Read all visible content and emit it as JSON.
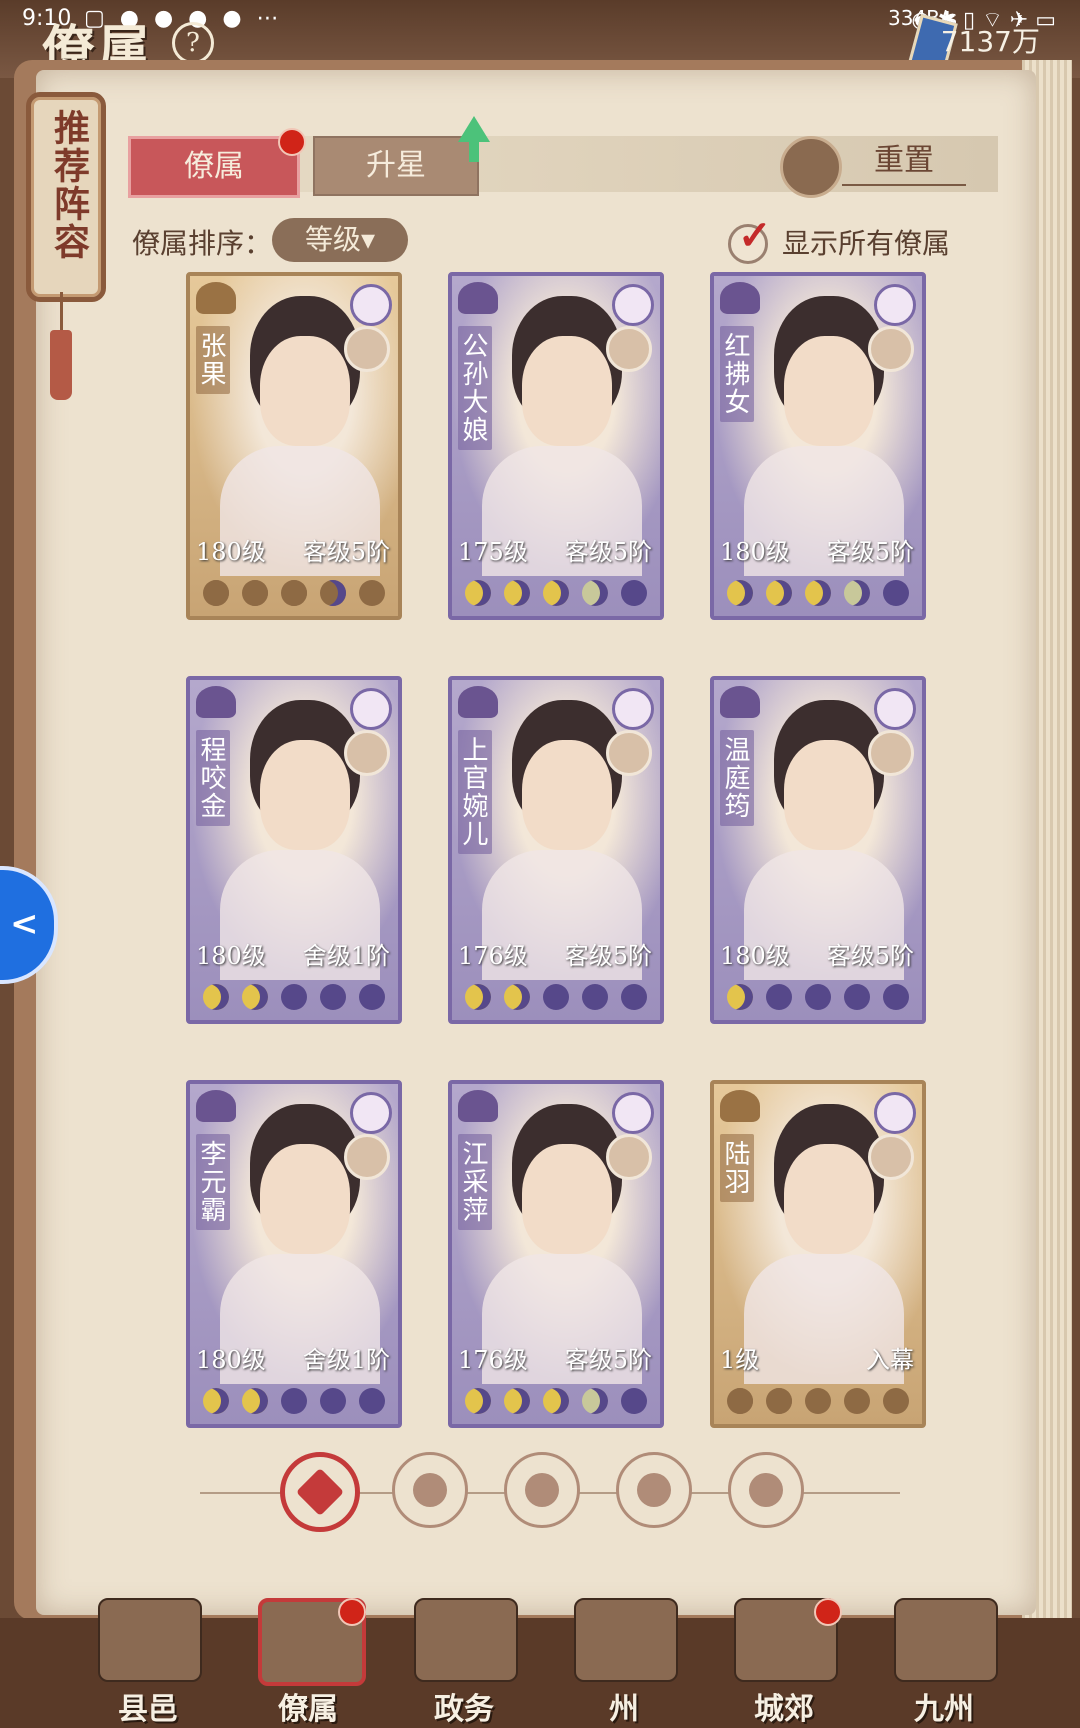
{
  "statusbar": {
    "time": "9:10",
    "notif_icons": "▢ ● ● ● ● ⋯",
    "speed": "334B/s",
    "right_icons": "◉ ✱ ▯ ⌔ ✈ ▭"
  },
  "header": {
    "title": "僚属",
    "help": "?",
    "currency": "7137万"
  },
  "recommend_tag": "推荐阵容",
  "tabs": [
    {
      "label": "僚属"
    },
    {
      "label": "升星"
    }
  ],
  "reset_label": "重置",
  "sort": {
    "label": "僚属排序：",
    "value": "等级▾"
  },
  "show_all": {
    "check": "✓",
    "label": "显示所有僚属"
  },
  "cards": [
    {
      "name": "张果",
      "level": "180级",
      "rank": "客级5阶",
      "theme": "gold",
      "moons": [
        2,
        2,
        2,
        1,
        0
      ]
    },
    {
      "name": "公孙大娘",
      "level": "175级",
      "rank": "客级5阶",
      "theme": "purple",
      "moons": [
        2,
        2,
        2,
        1,
        0
      ]
    },
    {
      "name": "红拂女",
      "level": "180级",
      "rank": "客级5阶",
      "theme": "purple",
      "moons": [
        2,
        2,
        2,
        1,
        0
      ]
    },
    {
      "name": "程咬金",
      "level": "180级",
      "rank": "舍级1阶",
      "theme": "purple",
      "moons": [
        2,
        2,
        0,
        0,
        0
      ]
    },
    {
      "name": "上官婉儿",
      "level": "176级",
      "rank": "客级5阶",
      "theme": "purple",
      "moons": [
        2,
        2,
        0,
        0,
        0
      ]
    },
    {
      "name": "温庭筠",
      "level": "180级",
      "rank": "客级5阶",
      "theme": "purple",
      "moons": [
        2,
        0,
        0,
        0,
        0
      ]
    },
    {
      "name": "李元霸",
      "level": "180级",
      "rank": "舍级1阶",
      "theme": "purple",
      "moons": [
        2,
        2,
        0,
        0,
        0
      ]
    },
    {
      "name": "江采萍",
      "level": "176级",
      "rank": "客级5阶",
      "theme": "purple",
      "moons": [
        2,
        2,
        2,
        1,
        0
      ]
    },
    {
      "name": "陆羽",
      "level": "1级",
      "rank": "入幕",
      "theme": "gold",
      "moons": [
        2,
        2,
        0,
        0,
        0
      ]
    }
  ],
  "filters": [
    "all-filter",
    "scholar-filter",
    "gourd-filter",
    "fan-filter",
    "lion-filter"
  ],
  "bottom_nav": [
    {
      "label": "县邑"
    },
    {
      "label": "僚属"
    },
    {
      "label": "政务"
    },
    {
      "label": "州"
    },
    {
      "label": "城郊"
    },
    {
      "label": "九州"
    }
  ]
}
